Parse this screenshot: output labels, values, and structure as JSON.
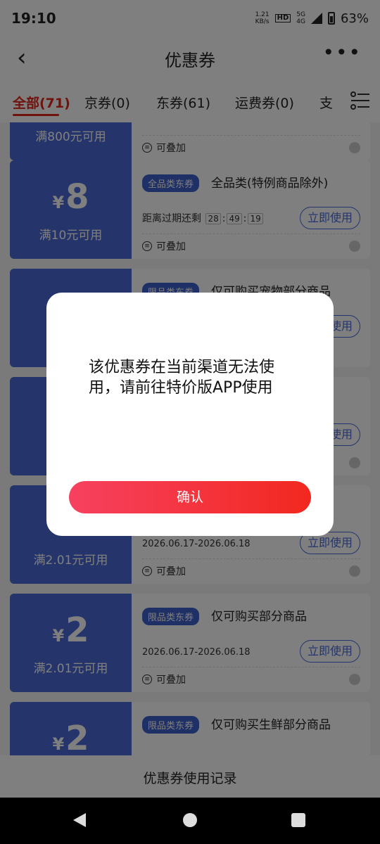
{
  "status_bar": {
    "time": "19:10",
    "net_speed": "1.21",
    "net_unit": "KB/s",
    "net_type": "HD",
    "net_gen1": "5G",
    "net_gen2": "4G",
    "battery": "63%"
  },
  "nav": {
    "title": "优惠券"
  },
  "tabs": [
    {
      "label": "全部(71)",
      "active": true
    },
    {
      "label": "京券(0)"
    },
    {
      "label": "东券(61)"
    },
    {
      "label": "运费券(0)"
    },
    {
      "label": "支"
    }
  ],
  "coupons": [
    {
      "amount": "",
      "condition": "满800元可用",
      "tag": "",
      "desc": "",
      "line2": "",
      "button": "",
      "stack": "可叠加"
    },
    {
      "amount": "8",
      "condition": "满10元可用",
      "tag": "全品类东券",
      "desc": "全品类(特例商品除外)",
      "timer_label": "距离过期还剩",
      "timer": [
        "28",
        "49",
        "19"
      ],
      "button": "立即使用",
      "stack": "可叠加"
    },
    {
      "amount": "",
      "condition": "",
      "tag": "限品类东券",
      "desc": "仅可购买宠物部分商品",
      "line2": "",
      "button": "立即使用",
      "stack": ""
    },
    {
      "amount": "",
      "condition": "",
      "tag": "",
      "desc": "",
      "line2": "",
      "button": "立即使用",
      "stack": ""
    },
    {
      "amount": "",
      "condition": "满2.01元可用",
      "tag": "",
      "desc": "",
      "line2": "2026.06.17-2026.06.18",
      "button": "立即使用",
      "stack": "可叠加"
    },
    {
      "amount": "2",
      "condition": "满2.01元可用",
      "tag": "限品类东券",
      "desc": "仅可购买部分商品",
      "line2": "2026.06.17-2026.06.18",
      "button": "立即使用",
      "stack": "可叠加"
    },
    {
      "amount": "2",
      "condition": "",
      "tag": "限品类东券",
      "desc": "仅可购买生鲜部分商品",
      "line2": "",
      "button": "",
      "stack": ""
    }
  ],
  "bottom_link": "优惠券使用记录",
  "dialog": {
    "message": "该优惠券在当前渠道无法使用，请前往特价版APP使用",
    "confirm_label": "确认"
  },
  "colors": {
    "accent": "#e0251b",
    "coupon_blue": "#4a6bd6",
    "confirm_start": "#f74160",
    "confirm_end": "#f2281f"
  }
}
